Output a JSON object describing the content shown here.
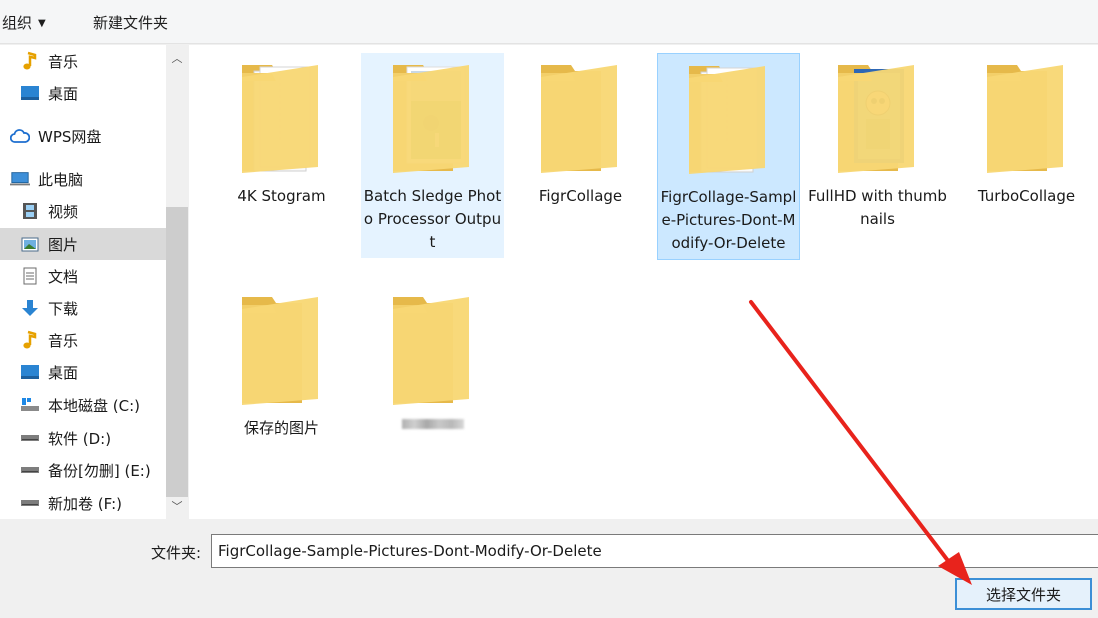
{
  "toolbar": {
    "organize_label": "组织",
    "new_folder_label": "新建文件夹"
  },
  "nav": {
    "items": [
      {
        "label": "音乐",
        "icon": "music-note-icon"
      },
      {
        "label": "桌面",
        "icon": "desktop-icon"
      },
      {
        "label": "WPS网盘",
        "icon": "cloud-icon"
      },
      {
        "label": "此电脑",
        "icon": "computer-icon"
      },
      {
        "label": "视频",
        "icon": "video-icon"
      },
      {
        "label": "图片",
        "icon": "picture-icon",
        "selected": true
      },
      {
        "label": "文档",
        "icon": "document-icon"
      },
      {
        "label": "下载",
        "icon": "download-arrow-icon"
      },
      {
        "label": "音乐",
        "icon": "music-note-icon"
      },
      {
        "label": "桌面",
        "icon": "desktop-icon"
      },
      {
        "label": "本地磁盘 (C:)",
        "icon": "system-drive-icon"
      },
      {
        "label": "软件 (D:)",
        "icon": "drive-icon"
      },
      {
        "label": "备份[勿删] (E:)",
        "icon": "drive-icon"
      },
      {
        "label": "新加卷 (F:)",
        "icon": "drive-icon"
      }
    ]
  },
  "folders": [
    {
      "name": "4K Stogram",
      "state": "normal",
      "content": "documents"
    },
    {
      "name": "Batch Sledge Photo Processor Output",
      "state": "hover",
      "content": "photo"
    },
    {
      "name": "FigrCollage",
      "state": "normal",
      "content": "empty"
    },
    {
      "name": "FigrCollage-Sample-Pictures-Dont-Modify-Or-Delete",
      "state": "selected",
      "content": "documents"
    },
    {
      "name": "FullHD with thumbnails",
      "state": "normal",
      "content": "cartoon"
    },
    {
      "name": "TurboCollage",
      "state": "normal",
      "content": "empty"
    },
    {
      "name": "保存的图片",
      "state": "normal",
      "content": "empty"
    },
    {
      "name": "",
      "state": "normal",
      "content": "empty",
      "blurred": true
    }
  ],
  "footer": {
    "folder_label": "文件夹:",
    "folder_value": "FigrCollage-Sample-Pictures-Dont-Modify-Or-Delete",
    "select_button": "选择文件夹"
  },
  "colors": {
    "folder_yellow": "#f8d775",
    "selection_blue": "#cce8ff",
    "arrow_red": "#e8231c"
  }
}
